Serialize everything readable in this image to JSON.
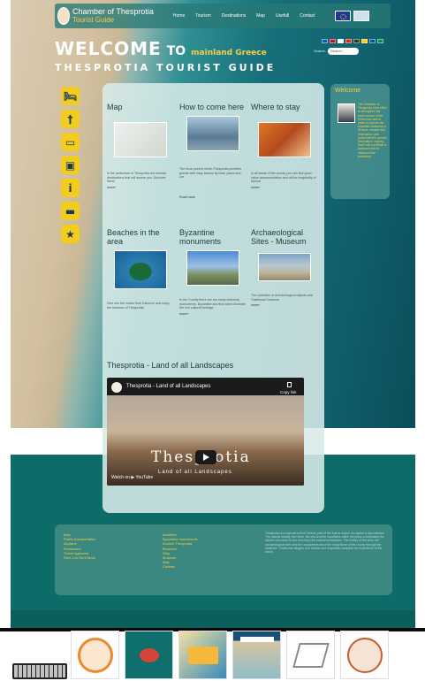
{
  "header": {
    "logo_line1": "Chamber of Thesprotia",
    "logo_line2": "Tourist Guide",
    "nav": [
      "Home",
      "Tourism",
      "Destinations",
      "Map",
      "Usefull",
      "Contact"
    ]
  },
  "welcome": {
    "big": "WELCOME",
    "to": "TO",
    "sub": "mainland Greece",
    "guide": "THESPROTIA TOURIST GUIDE"
  },
  "search": {
    "label": "Search...",
    "placeholder": "Search..."
  },
  "side_icons": [
    "hotel-icon",
    "restaurant-icon",
    "car-icon",
    "bus-icon",
    "info-icon",
    "rental-icon",
    "activities-icon"
  ],
  "cards": [
    {
      "title": "Map",
      "text": "In the prefecture of Thesprotia are several destinations that will amaze you. Discover them!",
      "more": "more»"
    },
    {
      "title": "How to come here",
      "text": "The focal point in which Thesprotia provides guests with easy access by boat, plane and car.",
      "more": "Read more"
    },
    {
      "title": "Where to stay",
      "text": "In all areas of the county you can find good value accommodation and all the hospitality of Epirus!",
      "more": "more»"
    },
    {
      "title": "Beaches in the area",
      "text": "Dive into the Ionian Sea! Discover and enjoy the beaches of Thesprotia.",
      "more": "more»"
    },
    {
      "title": "Byzantine monuments",
      "text": "In the County there are too many historical monuments. Byzantine and find which illustrate the rich cultural heritage.",
      "more": "more»"
    },
    {
      "title": "Archaeological Sites - Museum",
      "text": "The collection of Archaeological objects and Traditional Costume",
      "more": "more»"
    }
  ],
  "video": {
    "section_title": "Thesprotia - Land of all Landscapes",
    "player_title": "Thesprotia - Land of all Landscapes",
    "copy_link": "Copy link",
    "overlay_big": "Thesprotia",
    "overlay_small": "Land of all Landscapes",
    "watch_on": "Watch on ▶ YouTube"
  },
  "sidebar": {
    "title": "Welcome",
    "text": "The Chamber of Thesprotia in its effort to strengthen the local tourism in the Prefecture and in order to explore the important business in its area, created this information web portal with the precise information, hoping that it will constitute a pleasant visit for visitors of the prefecture."
  },
  "footer": {
    "col1": [
      "Map",
      "Public transportation",
      "Airplane",
      "Restaurant",
      "Travel Agencies",
      "Rent Car-Rent Moto"
    ],
    "col2": [
      "Activities",
      "Byzantine monuments",
      "Ancient Thesprotia",
      "Beaches",
      "Stay",
      "Museum",
      "Map",
      "Contact"
    ],
    "text": "Thesprotia is a regional unit of Greece, part of the Epirus region. Its capital is Igoumenitsa. The natural beauty, the rivers, the sea and the mountains make the place a destination for visitors who want to see and enjoy the natural landscapes. The history of the area, the archaeological sites and the monuments show the importance of the county through the centuries. Traditional villages, rich cuisine and hospitality complete the experience of the visitor."
  },
  "partners": [
    "Chamber of Thesprotia",
    "Mainland Greece Thesprotia",
    "Gets Routes",
    "Welcome to Thesprotia Tourist Guide",
    "Archaeological Museum of Igoumenitsa",
    "Municipality logo"
  ],
  "colors": {
    "accent_yellow": "#f2d045",
    "icon_yellow": "#f2cc1e",
    "teal": "#0e6c68",
    "panel": "#d7ebe8"
  }
}
